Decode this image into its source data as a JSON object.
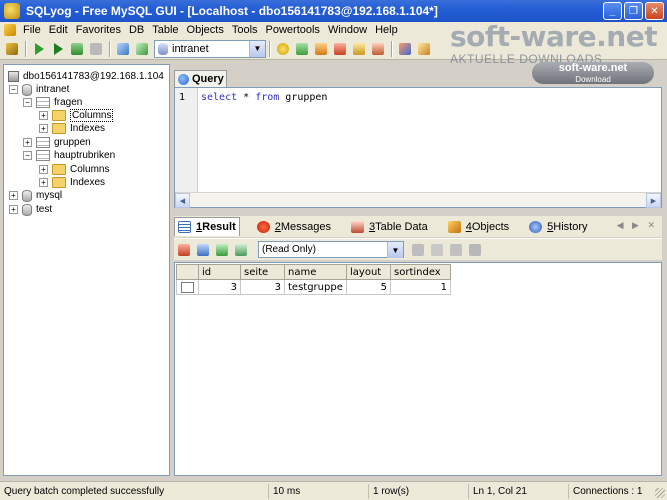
{
  "window": {
    "title": "SQLyog - Free MySQL GUI - [Localhost - dbo156141783@192.168.1.104*]"
  },
  "menu": [
    "File",
    "Edit",
    "Favorites",
    "DB",
    "Table",
    "Objects",
    "Tools",
    "Powertools",
    "Window",
    "Help"
  ],
  "toolbar": {
    "database_selected": "intranet"
  },
  "watermark": {
    "title": "soft-ware.net",
    "subtitle": "AKTUELLE DOWNLOADS",
    "badge_title": "soft-ware.net",
    "badge_sub": "Download"
  },
  "tree": {
    "root": "dbo156141783@192.168.1.104",
    "nodes": {
      "intranet": "intranet",
      "fragen": "fragen",
      "fragen_columns": "Columns",
      "fragen_indexes": "Indexes",
      "gruppen": "gruppen",
      "hauptrubriken": "hauptrubriken",
      "haupt_columns": "Columns",
      "haupt_indexes": "Indexes",
      "mysql": "mysql",
      "test": "test"
    }
  },
  "query_tab": {
    "label": "Query"
  },
  "editor": {
    "line_number": "1",
    "kw_select": "select",
    "star": " * ",
    "kw_from": "from",
    "table": " gruppen"
  },
  "result_tabs": [
    {
      "num": "1",
      "label": " Result"
    },
    {
      "num": "2",
      "label": " Messages"
    },
    {
      "num": "3",
      "label": " Table Data"
    },
    {
      "num": "4",
      "label": " Objects"
    },
    {
      "num": "5",
      "label": " History"
    }
  ],
  "result_toolbar": {
    "mode": "(Read Only)"
  },
  "grid": {
    "columns": [
      "id",
      "seite",
      "name",
      "layout",
      "sortindex"
    ],
    "rows": [
      [
        "3",
        "3",
        "testgruppe",
        "5",
        "1"
      ]
    ]
  },
  "status": {
    "message": "Query batch completed successfully",
    "time": "10 ms",
    "rows": "1 row(s)",
    "position": "Ln 1, Col 21",
    "connections": "Connections : 1"
  },
  "colors": {
    "titlebar": "#245ed6",
    "keyword": "#3030c0",
    "chrome": "#ece9d8"
  }
}
